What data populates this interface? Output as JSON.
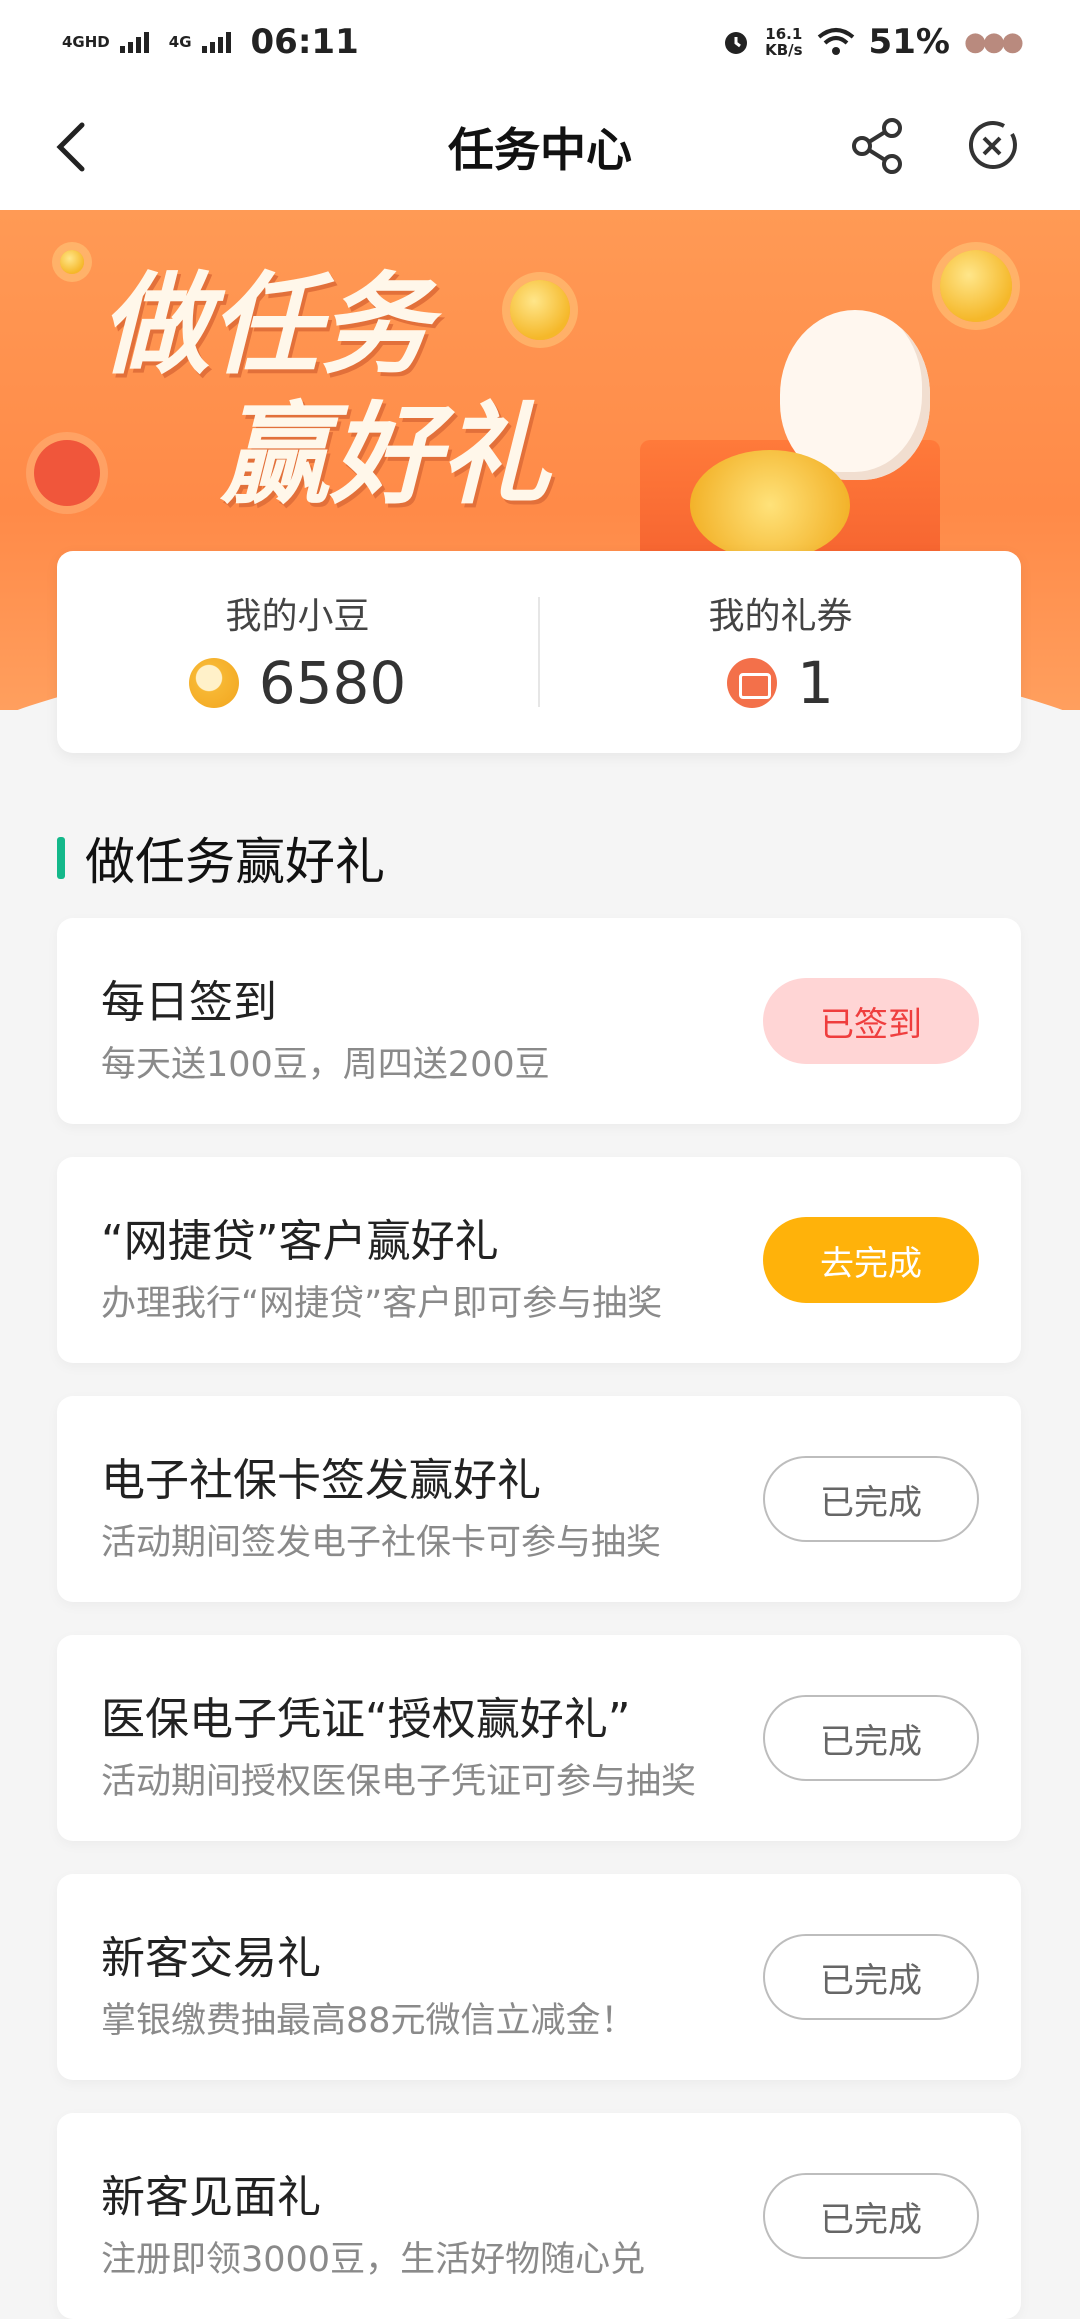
{
  "status_bar": {
    "net1": "4GHD",
    "net2": "4G",
    "time": "06:11",
    "speed_value": "16.1",
    "speed_unit": "KB/s",
    "battery": "51%"
  },
  "nav": {
    "title": "任务中心"
  },
  "banner": {
    "line1": "做任务",
    "line2": "赢好礼"
  },
  "stats": {
    "beans_label": "我的小豆",
    "beans_value": "6580",
    "coupons_label": "我的礼券",
    "coupons_value": "1"
  },
  "section": {
    "title": "做任务赢好礼"
  },
  "tasks": [
    {
      "title": "每日签到",
      "desc": "每天送100豆，周四送200豆",
      "button": "已签到",
      "state": "signed"
    },
    {
      "title": "“网捷贷”客户赢好礼",
      "desc": "办理我行“网捷贷”客户即可参与抽奖",
      "button": "去完成",
      "state": "todo"
    },
    {
      "title": "电子社保卡签发赢好礼",
      "desc": "活动期间签发电子社保卡可参与抽奖",
      "button": "已完成",
      "state": "done"
    },
    {
      "title": "医保电子凭证“授权赢好礼”",
      "desc": "活动期间授权医保电子凭证可参与抽奖",
      "button": "已完成",
      "state": "done"
    },
    {
      "title": "新客交易礼",
      "desc": "掌银缴费抽最高88元微信立减金！",
      "button": "已完成",
      "state": "done"
    },
    {
      "title": "新客见面礼",
      "desc": "注册即领3000豆，生活好物随心兑",
      "button": "已完成",
      "state": "done"
    }
  ],
  "colors": {
    "accent_green": "#14b88a",
    "banner_orange": "#ff8a48",
    "todo_button": "#ffb20a",
    "signed_button_bg": "#ffd5d5",
    "signed_button_text": "#ef3e3e"
  }
}
